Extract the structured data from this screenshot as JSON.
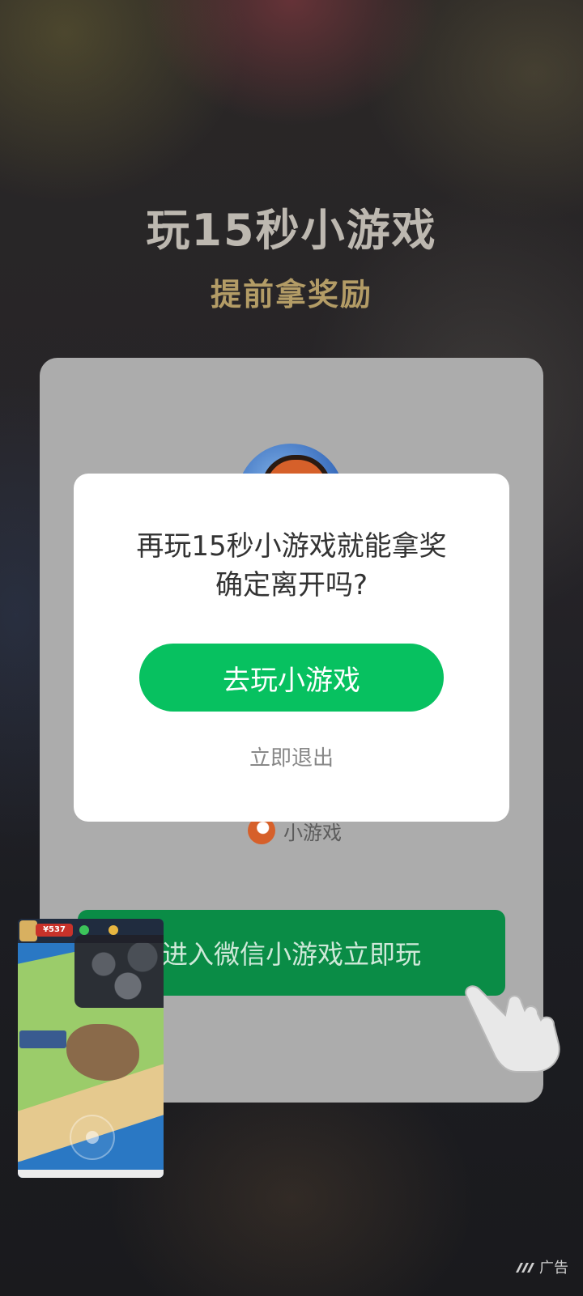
{
  "promo": {
    "headline": "玩15秒小游戏",
    "subline": "提前拿奖励"
  },
  "card": {
    "brand_label": "小游戏",
    "enter_button": "进入微信小游戏立即玩"
  },
  "thumbnail": {
    "money": "¥537"
  },
  "dialog": {
    "message_line1": "再玩15秒小游戏就能拿奖",
    "message_line2": "确定离开吗?",
    "play_button": "去玩小游戏",
    "exit_link": "立即退出"
  },
  "ad_badge": {
    "label": "广告",
    "icon": "ad-platform-icon"
  },
  "colors": {
    "accent_green": "#07c160",
    "enter_green": "#0a8c46",
    "gold_text": "#b39c66"
  }
}
